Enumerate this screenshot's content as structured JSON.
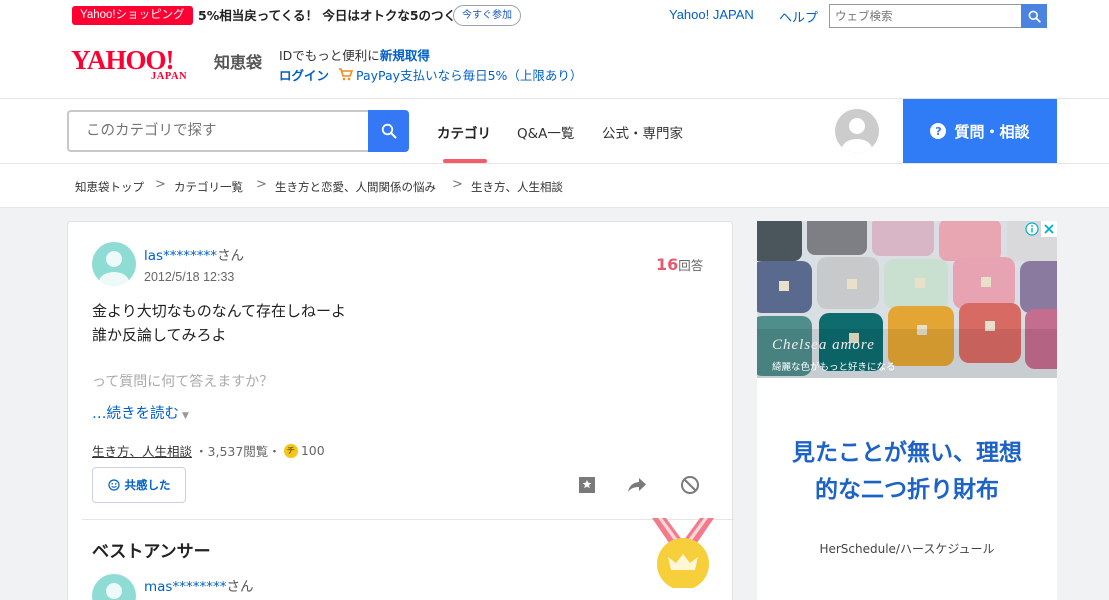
{
  "topbar": {
    "promo_pill": "Yahoo!ショッピング",
    "promo_text": "5%相当戻ってくる！ 今日はオトクな5のつく日",
    "promo_button": "今すぐ参加",
    "link_japan": "Yahoo! JAPAN",
    "link_help": "ヘルプ",
    "web_search_placeholder": "ウェブ検索"
  },
  "header": {
    "logo_yahoo": "YAHOO!",
    "logo_japan": "JAPAN",
    "logo_service": "知恵袋",
    "line1_prefix": "IDでもっと便利に",
    "line1_link": "新規取得",
    "login": "ログイン",
    "paypay": "PayPay支払いなら毎日5%（上限あり）"
  },
  "nav": {
    "search_placeholder": "このカテゴリで探す",
    "tabs": [
      "カテゴリ",
      "Q&A一覧",
      "公式・専門家"
    ],
    "ask_button": "質問・相談",
    "ask_icon_glyph": "?"
  },
  "breadcrumb": [
    "知恵袋トップ",
    "カテゴリ一覧",
    "生き方と恋愛、人間関係の悩み",
    "生き方、人生相談"
  ],
  "breadcrumb_separator": ">",
  "question": {
    "user": "las********",
    "honorific": "さん",
    "date": "2012/5/18 12:33",
    "answer_count": "16",
    "answer_unit": "回答",
    "body_lines": [
      "金より大切なものなんて存在しねーよ",
      "誰か反論してみろよ"
    ],
    "faded_line": "って質問に何て答えますか？",
    "read_more": "…続きを読む",
    "category": "生き方、人生相談",
    "views": "・3,537閲覧・",
    "coin_glyph": "チ",
    "coins": "100",
    "empathy_button": "共感した"
  },
  "best_answer": {
    "title": "ベストアンサー",
    "user": "mas********",
    "honorific": "さん"
  },
  "ad": {
    "script_text": "Chelsea amore",
    "caption": "綺麗な色がもっと好きになる",
    "headline_line1": "見たことが無い、理想",
    "headline_line2": "的な二つ折り財布",
    "brand": "HerSchedule/ハースケジュール"
  },
  "colors": {
    "brand_red": "#ff0033",
    "link_blue": "#0060c7",
    "ask_blue": "#2f7cf6",
    "accent_pink": "#f25c6b",
    "ad_headline_blue": "#1c63c5"
  }
}
